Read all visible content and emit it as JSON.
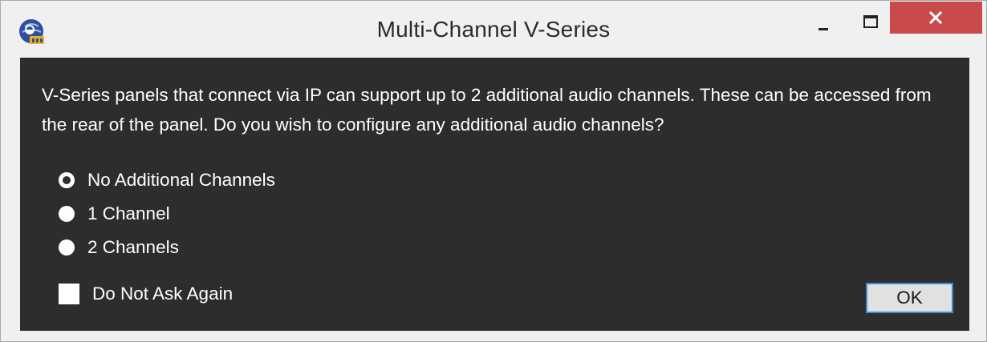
{
  "window": {
    "title": "Multi-Channel V-Series",
    "app_icon": "globe-logo-icon",
    "controls": {
      "minimize_icon": "minimize-icon",
      "maximize_icon": "maximize-icon",
      "close_icon": "close-icon",
      "close_color": "#c84a4a"
    }
  },
  "dialog": {
    "message": "V-Series panels that connect via IP can support up to 2 additional audio channels. These can be accessed from the rear of the panel. Do you wish to configure any additional audio channels?",
    "options": [
      {
        "label": "No Additional Channels",
        "checked": true
      },
      {
        "label": "1 Channel",
        "checked": false
      },
      {
        "label": "2 Channels",
        "checked": false
      }
    ],
    "checkbox": {
      "label": "Do Not Ask Again",
      "checked": false
    },
    "ok_label": "OK",
    "background_color": "#2d2d2d",
    "focus_color": "#3c8ad6"
  }
}
